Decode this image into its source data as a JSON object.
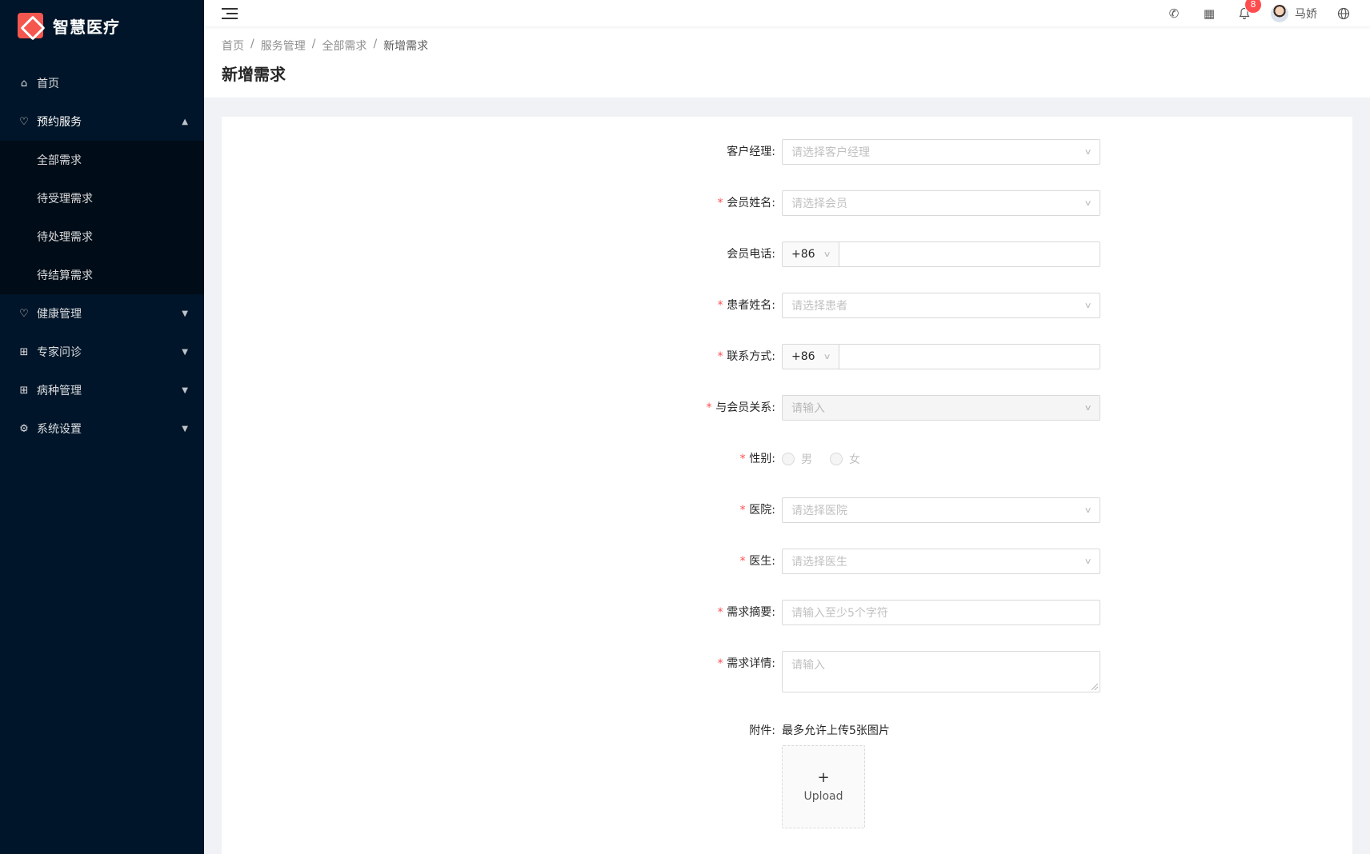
{
  "app": {
    "title": "智慧医疗"
  },
  "sidebar": {
    "items": [
      {
        "label": "首页",
        "icon": "home-icon"
      },
      {
        "label": "预约服务",
        "icon": "heart-shield-icon",
        "expanded": true,
        "children": [
          "全部需求",
          "待受理需求",
          "待处理需求",
          "待结算需求"
        ]
      },
      {
        "label": "健康管理",
        "icon": "heartbeat-icon"
      },
      {
        "label": "专家问诊",
        "icon": "medical-box-icon"
      },
      {
        "label": "病种管理",
        "icon": "medical-box-icon"
      },
      {
        "label": "系统设置",
        "icon": "gear-icon"
      }
    ]
  },
  "header": {
    "notification_count": "8",
    "user_name": "马娇",
    "icons": [
      "phone-icon",
      "apps-icon",
      "bell-icon",
      "globe-icon"
    ]
  },
  "breadcrumb": [
    "首页",
    "服务管理",
    "全部需求",
    "新增需求"
  ],
  "page_title": "新增需求",
  "form": {
    "manager": {
      "label": "客户经理:",
      "placeholder": "请选择客户经理"
    },
    "member_name": {
      "label": "会员姓名:",
      "placeholder": "请选择会员"
    },
    "member_phone": {
      "label": "会员电话:",
      "prefix": "+86"
    },
    "patient_name": {
      "label": "患者姓名:",
      "placeholder": "请选择患者"
    },
    "contact": {
      "label": "联系方式:",
      "prefix": "+86"
    },
    "relation": {
      "label": "与会员关系:",
      "placeholder": "请输入"
    },
    "gender": {
      "label": "性别:",
      "options": [
        "男",
        "女"
      ]
    },
    "hospital": {
      "label": "医院:",
      "placeholder": "请选择医院"
    },
    "doctor": {
      "label": "医生:",
      "placeholder": "请选择医生"
    },
    "summary": {
      "label": "需求摘要:",
      "placeholder": "请输入至少5个字符"
    },
    "detail": {
      "label": "需求详情:",
      "placeholder": "请输入"
    },
    "attachment": {
      "label": "附件:",
      "hint": "最多允许上传5张图片",
      "upload_label": "Upload"
    }
  },
  "colors": {
    "sidebar_bg": "#001529",
    "submenu_bg": "#000c17",
    "required": "#ff4d4f",
    "logo": "#f5574f"
  }
}
